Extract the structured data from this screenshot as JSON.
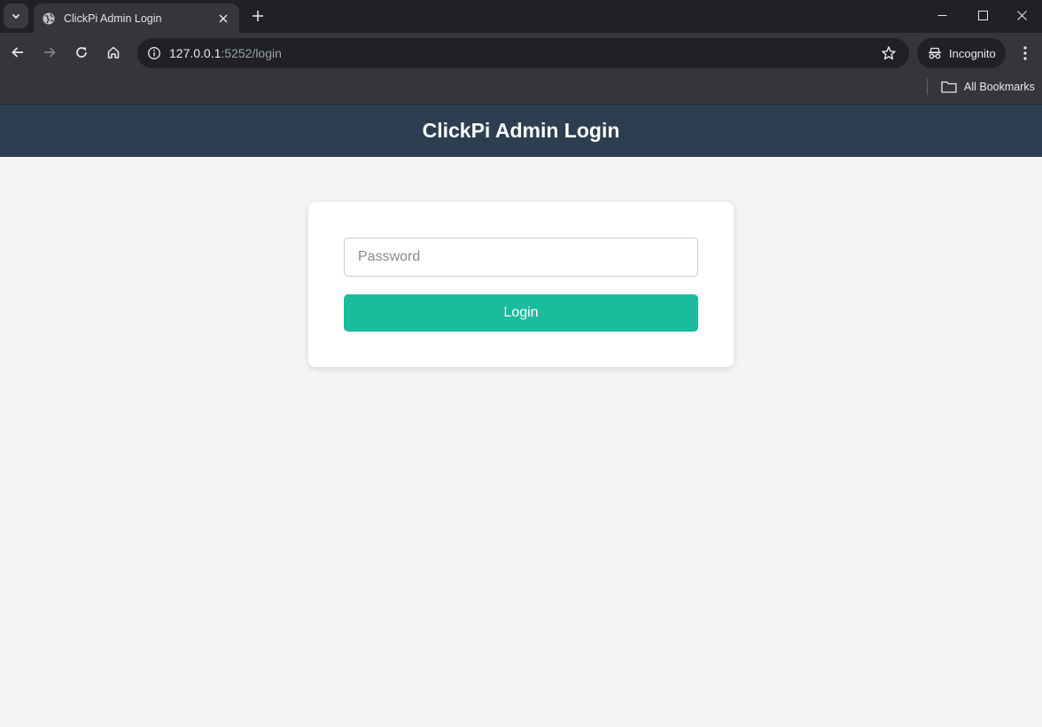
{
  "browser": {
    "tab": {
      "title": "ClickPi Admin Login"
    },
    "address": {
      "host": "127.0.0.1",
      "rest": ":5252/login"
    },
    "profile_label": "Incognito",
    "bookmarks_label": "All Bookmarks"
  },
  "page": {
    "header_title": "ClickPi Admin Login",
    "form": {
      "password_placeholder": "Password",
      "login_label": "Login"
    }
  },
  "colors": {
    "header_bg": "#2c3e50",
    "button_bg": "#1abc9c",
    "page_bg": "#f4f4f5"
  },
  "icons": {
    "tab_search": "chevron-down-icon",
    "favicon": "globe-icon",
    "tab_close": "close-icon",
    "new_tab": "plus-icon",
    "back": "arrow-left-icon",
    "forward": "arrow-right-icon",
    "reload": "reload-icon",
    "home": "home-icon",
    "site_info": "info-icon",
    "bookmark_star": "star-icon",
    "incognito": "incognito-icon",
    "menu": "kebab-menu-icon",
    "bookmarks_folder": "folder-icon"
  }
}
